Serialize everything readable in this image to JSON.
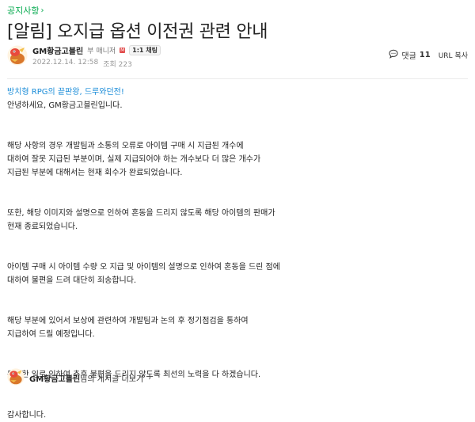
{
  "breadcrumb": {
    "label": "공지사항",
    "chevron": "›"
  },
  "post": {
    "title": "[알림] 오지급 옵션 이전권 관련 안내",
    "author": {
      "name": "GM황금고블린",
      "role": "부 매니저",
      "manager_badge": "M",
      "chat_label": "1:1 채팅"
    },
    "date": "2022.12.14. 12:58",
    "views_label": "조회 223"
  },
  "tools": {
    "comment_label": "댓글",
    "comment_count": "11",
    "url_copy": "URL 복사"
  },
  "content": {
    "lead": "방치형 RPG의 끝판왕, 드루와던전!",
    "greeting": "안녕하세요, GM황금고블린입니다.",
    "p1_l1": "해당 사항의 경우 개발팀과 소통의 오류로 아이템 구매 시 지급된 개수에",
    "p1_l2": "대하여 잘못 지급된 부분이며, 실제 지급되어야 하는 개수보다 더 많은 개수가",
    "p1_l3": "지급된 부분에 대해서는 현재 회수가 완료되었습니다.",
    "p2_l1": "또한, 해당 이미지와 설명으로 인하여 혼동을 드리지 않도록 해당 아이템의 판매가",
    "p2_l2": "현재 종료되었습니다.",
    "p3_l1": "아이템 구매 시 아이템 수량 오 지급 및 아이템의 설명으로 인하여 혼동을 드린 점에",
    "p3_l2": "대하여 불편을 드려 대단히 죄송합니다.",
    "p4_l1": "해당 부분에 있어서 보상에 관련하여 개발팀과 논의 후 정기점검을 통하여",
    "p4_l2": "지급하여 드릴 예정입니다.",
    "p5_l1": "동일한 일로 인하여 추후 불편을 드리지 않도록 최선의 노력을 다 하겠습니다.",
    "closing": "감사합니다."
  },
  "footer": {
    "author_name": "GM황금고블린",
    "suffix": "님의 게시글 더보기",
    "chevron": "›"
  },
  "icons": {
    "avatar": "goblin-avatar-icon",
    "comment": "speech-bubble-icon"
  },
  "colors": {
    "accent_green": "#03a94d",
    "lead_blue": "#1a8cd8",
    "badge_red": "#e14a4a"
  }
}
